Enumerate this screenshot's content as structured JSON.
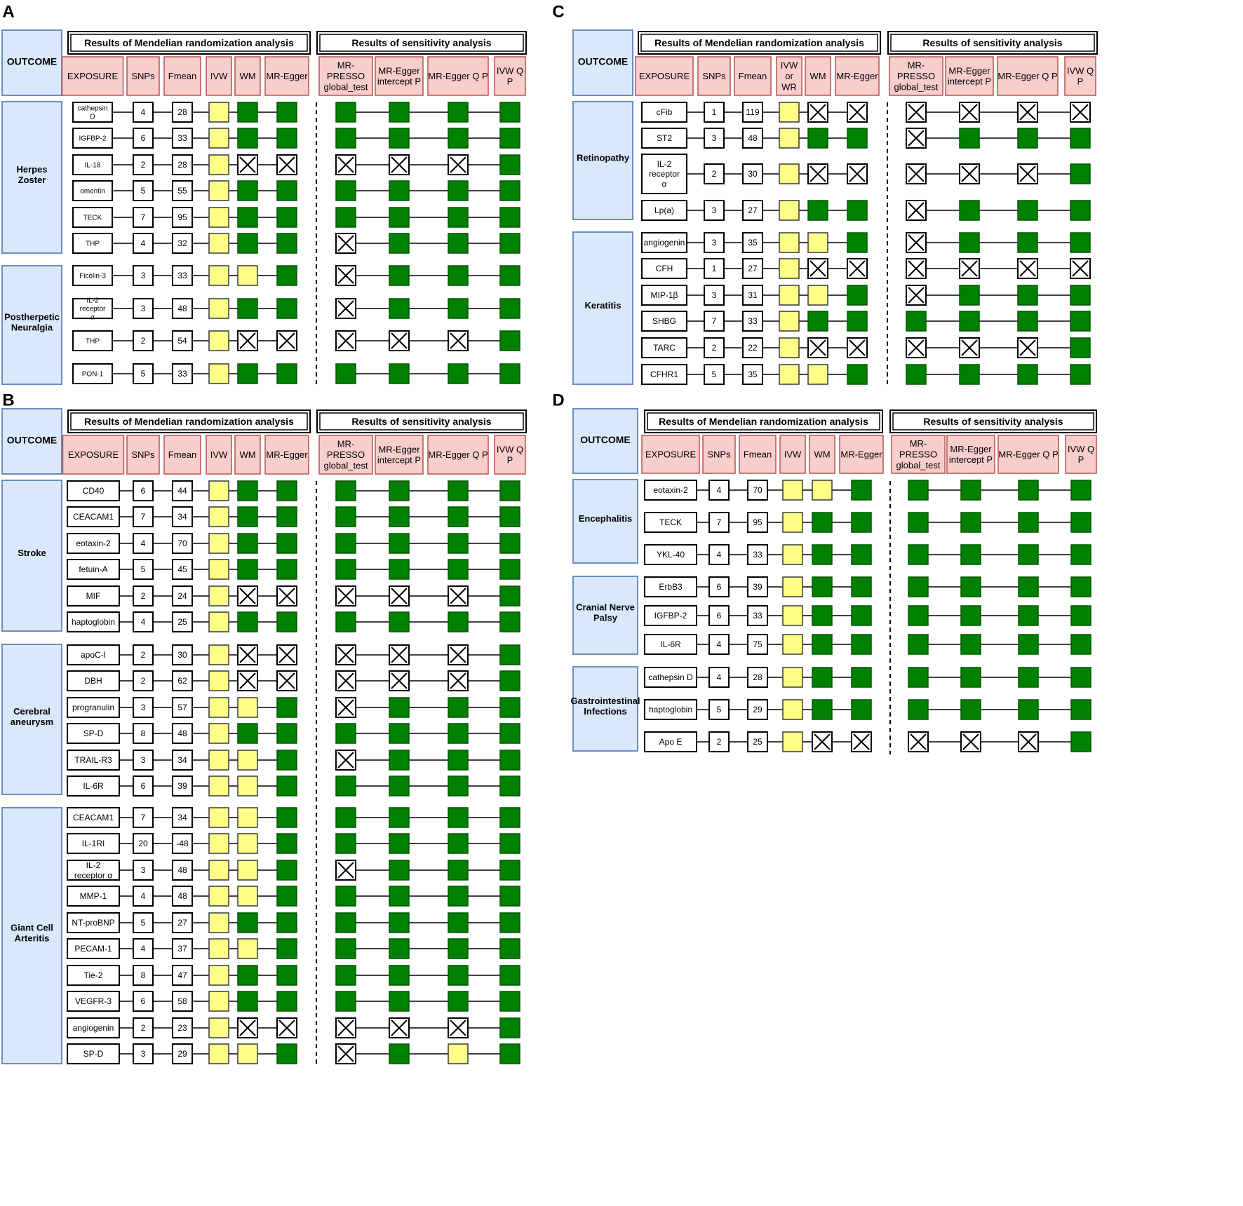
{
  "legend_colors": {
    "header_fill": "#f8cecc",
    "header_stroke": "#b85450",
    "outcome_fill": "#dae8fc",
    "outcome_stroke": "#6c8ebf",
    "ivw_yellow": "#ffff88",
    "sig_green": "#008000",
    "x_box": "cross"
  },
  "cell_codes": {
    "Y": "yellow box",
    "G": "green box",
    "X": "box with cross"
  },
  "panels": [
    {
      "letter": "A",
      "outcome_header": "OUTCOME",
      "mr_title": "Results of Mendelian randomization analysis",
      "sens_title": "Results of sensitivity analysis",
      "col_headers": [
        "EXPOSURE",
        "SNPs",
        "Fmean",
        "IVW",
        "WM",
        "MR-Egger",
        "MR-PRESSO global_test",
        "MR-Egger intercept P",
        "MR-Egger Q P",
        "IVW Q P"
      ],
      "groups": [
        {
          "outcome": "Herpes Zoster",
          "rows": [
            {
              "exposure": "cathepsin D",
              "snps": "4",
              "fmean": "28",
              "cells": [
                "Y",
                "G",
                "G",
                "G",
                "G",
                "G",
                "G"
              ]
            },
            {
              "exposure": "IGFBP-2",
              "snps": "6",
              "fmean": "33",
              "cells": [
                "Y",
                "G",
                "G",
                "G",
                "G",
                "G",
                "G"
              ]
            },
            {
              "exposure": "IL-18",
              "snps": "2",
              "fmean": "28",
              "cells": [
                "Y",
                "X",
                "X",
                "X",
                "X",
                "X",
                "G"
              ]
            },
            {
              "exposure": "omentin",
              "snps": "5",
              "fmean": "55",
              "cells": [
                "Y",
                "G",
                "G",
                "G",
                "G",
                "G",
                "G"
              ]
            },
            {
              "exposure": "TECK",
              "snps": "7",
              "fmean": "95",
              "cells": [
                "Y",
                "G",
                "G",
                "G",
                "G",
                "G",
                "G"
              ]
            },
            {
              "exposure": "THP",
              "snps": "4",
              "fmean": "32",
              "cells": [
                "Y",
                "G",
                "G",
                "X",
                "G",
                "G",
                "G"
              ]
            }
          ]
        },
        {
          "outcome": "Postherpetic Neuralgia",
          "rows": [
            {
              "exposure": "Ficolin-3",
              "snps": "3",
              "fmean": "33",
              "cells": [
                "Y",
                "Y",
                "G",
                "X",
                "G",
                "G",
                "G"
              ]
            },
            {
              "exposure": "IL-2 receptor α",
              "snps": "3",
              "fmean": "48",
              "cells": [
                "Y",
                "G",
                "G",
                "X",
                "G",
                "G",
                "G"
              ]
            },
            {
              "exposure": "THP",
              "snps": "2",
              "fmean": "54",
              "cells": [
                "Y",
                "X",
                "X",
                "X",
                "X",
                "X",
                "G"
              ]
            },
            {
              "exposure": "PON-1",
              "snps": "5",
              "fmean": "33",
              "cells": [
                "Y",
                "G",
                "G",
                "G",
                "G",
                "G",
                "G"
              ]
            }
          ]
        }
      ]
    },
    {
      "letter": "B",
      "outcome_header": "OUTCOME",
      "mr_title": "Results of Mendelian randomization analysis",
      "sens_title": "Results of sensitivity analysis",
      "col_headers": [
        "EXPOSURE",
        "SNPs",
        "Fmean",
        "IVW",
        "WM",
        "MR-Egger",
        "MR-PRESSO global_test",
        "MR-Egger intercept P",
        "MR-Egger Q P",
        "IVW Q P"
      ],
      "groups": [
        {
          "outcome": "Stroke",
          "rows": [
            {
              "exposure": "CD40",
              "snps": "6",
              "fmean": "44",
              "cells": [
                "Y",
                "G",
                "G",
                "G",
                "G",
                "G",
                "G"
              ]
            },
            {
              "exposure": "CEACAM1",
              "snps": "7",
              "fmean": "34",
              "cells": [
                "Y",
                "G",
                "G",
                "G",
                "G",
                "G",
                "G"
              ]
            },
            {
              "exposure": "eotaxin-2",
              "snps": "4",
              "fmean": "70",
              "cells": [
                "Y",
                "G",
                "G",
                "G",
                "G",
                "G",
                "G"
              ]
            },
            {
              "exposure": "fetuin-A",
              "snps": "5",
              "fmean": "45",
              "cells": [
                "Y",
                "G",
                "G",
                "G",
                "G",
                "G",
                "G"
              ]
            },
            {
              "exposure": "MIF",
              "snps": "2",
              "fmean": "24",
              "cells": [
                "Y",
                "X",
                "X",
                "X",
                "X",
                "X",
                "G"
              ]
            },
            {
              "exposure": "haptoglobin",
              "snps": "4",
              "fmean": "25",
              "cells": [
                "Y",
                "G",
                "G",
                "G",
                "G",
                "G",
                "G"
              ]
            }
          ]
        },
        {
          "outcome": "Cerebral aneurysm",
          "rows": [
            {
              "exposure": "apoC-I",
              "snps": "2",
              "fmean": "30",
              "cells": [
                "Y",
                "X",
                "X",
                "X",
                "X",
                "X",
                "G"
              ]
            },
            {
              "exposure": "DBH",
              "snps": "2",
              "fmean": "62",
              "cells": [
                "Y",
                "X",
                "X",
                "X",
                "X",
                "X",
                "G"
              ]
            },
            {
              "exposure": "progranulin",
              "snps": "3",
              "fmean": "57",
              "cells": [
                "Y",
                "Y",
                "G",
                "X",
                "G",
                "G",
                "G"
              ]
            },
            {
              "exposure": "SP-D",
              "snps": "8",
              "fmean": "48",
              "cells": [
                "Y",
                "G",
                "G",
                "G",
                "G",
                "G",
                "G"
              ]
            },
            {
              "exposure": "TRAIL-R3",
              "snps": "3",
              "fmean": "34",
              "cells": [
                "Y",
                "Y",
                "G",
                "X",
                "G",
                "G",
                "G"
              ]
            },
            {
              "exposure": "IL-6R",
              "snps": "6",
              "fmean": "39",
              "cells": [
                "Y",
                "Y",
                "G",
                "G",
                "G",
                "G",
                "G"
              ]
            }
          ]
        },
        {
          "outcome": "Giant Cell Arteritis",
          "rows": [
            {
              "exposure": "CEACAM1",
              "snps": "7",
              "fmean": "34",
              "cells": [
                "Y",
                "Y",
                "G",
                "G",
                "G",
                "G",
                "G"
              ]
            },
            {
              "exposure": "IL-1RI",
              "snps": "20",
              "fmean": "-48",
              "cells": [
                "Y",
                "Y",
                "G",
                "G",
                "G",
                "G",
                "G"
              ]
            },
            {
              "exposure": "IL-2 receptor α",
              "snps": "3",
              "fmean": "48",
              "cells": [
                "Y",
                "Y",
                "G",
                "X",
                "G",
                "G",
                "G"
              ]
            },
            {
              "exposure": "MMP-1",
              "snps": "4",
              "fmean": "48",
              "cells": [
                "Y",
                "Y",
                "G",
                "G",
                "G",
                "G",
                "G"
              ]
            },
            {
              "exposure": "NT-proBNP",
              "snps": "5",
              "fmean": "27",
              "cells": [
                "Y",
                "G",
                "G",
                "G",
                "G",
                "G",
                "G"
              ]
            },
            {
              "exposure": "PECAM-1",
              "snps": "4",
              "fmean": "37",
              "cells": [
                "Y",
                "Y",
                "G",
                "G",
                "G",
                "G",
                "G"
              ]
            },
            {
              "exposure": "Tie-2",
              "snps": "8",
              "fmean": "47",
              "cells": [
                "Y",
                "G",
                "G",
                "G",
                "G",
                "G",
                "G"
              ]
            },
            {
              "exposure": "VEGFR-3",
              "snps": "6",
              "fmean": "58",
              "cells": [
                "Y",
                "G",
                "G",
                "G",
                "G",
                "G",
                "G"
              ]
            },
            {
              "exposure": "angiogenin",
              "snps": "2",
              "fmean": "23",
              "cells": [
                "Y",
                "X",
                "X",
                "X",
                "X",
                "X",
                "G"
              ]
            },
            {
              "exposure": "SP-D",
              "snps": "3",
              "fmean": "29",
              "cells": [
                "Y",
                "Y",
                "G",
                "X",
                "G",
                "Y",
                "G"
              ]
            }
          ]
        }
      ]
    },
    {
      "letter": "C",
      "outcome_header": "OUTCOME",
      "mr_title": "Results of Mendelian randomization analysis",
      "sens_title": "Results of sensitivity analysis",
      "col_headers": [
        "EXPOSURE",
        "SNPs",
        "Fmean",
        "IVW or WR",
        "WM",
        "MR-Egger",
        "MR-PRESSO global_test",
        "MR-Egger intercept P",
        "MR-Egger Q P",
        "IVW Q P"
      ],
      "groups": [
        {
          "outcome": "Retinopathy",
          "rows": [
            {
              "exposure": "cFib",
              "snps": "1",
              "fmean": "119",
              "cells": [
                "Y",
                "X",
                "X",
                "X",
                "X",
                "X",
                "X"
              ]
            },
            {
              "exposure": "ST2",
              "snps": "3",
              "fmean": "48",
              "cells": [
                "Y",
                "G",
                "G",
                "X",
                "G",
                "G",
                "G"
              ]
            },
            {
              "exposure": "IL-2 receptor α",
              "snps": "2",
              "fmean": "30",
              "cells": [
                "Y",
                "X",
                "X",
                "X",
                "X",
                "X",
                "G"
              ]
            },
            {
              "exposure": "Lp(a)",
              "snps": "3",
              "fmean": "27",
              "cells": [
                "Y",
                "G",
                "G",
                "X",
                "G",
                "G",
                "G"
              ]
            }
          ]
        },
        {
          "outcome": "Keratitis",
          "rows": [
            {
              "exposure": "angiogenin",
              "snps": "3",
              "fmean": "35",
              "cells": [
                "Y",
                "Y",
                "G",
                "X",
                "G",
                "G",
                "G"
              ]
            },
            {
              "exposure": "CFH",
              "snps": "1",
              "fmean": "27",
              "cells": [
                "Y",
                "X",
                "X",
                "X",
                "X",
                "X",
                "X"
              ]
            },
            {
              "exposure": "MIP-1β",
              "snps": "3",
              "fmean": "31",
              "cells": [
                "Y",
                "Y",
                "G",
                "X",
                "G",
                "G",
                "G"
              ]
            },
            {
              "exposure": "SHBG",
              "snps": "7",
              "fmean": "33",
              "cells": [
                "Y",
                "G",
                "G",
                "G",
                "G",
                "G",
                "G"
              ]
            },
            {
              "exposure": "TARC",
              "snps": "2",
              "fmean": "22",
              "cells": [
                "Y",
                "X",
                "X",
                "X",
                "X",
                "X",
                "G"
              ]
            },
            {
              "exposure": "CFHR1",
              "snps": "5",
              "fmean": "35",
              "cells": [
                "Y",
                "Y",
                "G",
                "G",
                "G",
                "G",
                "G"
              ]
            }
          ]
        }
      ]
    },
    {
      "letter": "D",
      "outcome_header": "OUTCOME",
      "mr_title": "Results of Mendelian randomization analysis",
      "sens_title": "Results of sensitivity analysis",
      "col_headers": [
        "EXPOSURE",
        "SNPs",
        "Fmean",
        "IVW",
        "WM",
        "MR-Egger",
        "MR-PRESSO global_test",
        "MR-Egger intercept P",
        "MR-Egger Q P",
        "IVW Q P"
      ],
      "groups": [
        {
          "outcome": "Encephalitis",
          "rows": [
            {
              "exposure": "eotaxin-2",
              "snps": "4",
              "fmean": "70",
              "cells": [
                "Y",
                "Y",
                "G",
                "G",
                "G",
                "G",
                "G"
              ]
            },
            {
              "exposure": "TECK",
              "snps": "7",
              "fmean": "95",
              "cells": [
                "Y",
                "G",
                "G",
                "G",
                "G",
                "G",
                "G"
              ]
            },
            {
              "exposure": "YKL-40",
              "snps": "4",
              "fmean": "33",
              "cells": [
                "Y",
                "G",
                "G",
                "G",
                "G",
                "G",
                "G"
              ]
            }
          ]
        },
        {
          "outcome": "Cranial Nerve Palsy",
          "rows": [
            {
              "exposure": "ErbB3",
              "snps": "6",
              "fmean": "39",
              "cells": [
                "Y",
                "G",
                "G",
                "G",
                "G",
                "G",
                "G"
              ]
            },
            {
              "exposure": "IGFBP-2",
              "snps": "6",
              "fmean": "33",
              "cells": [
                "Y",
                "G",
                "G",
                "G",
                "G",
                "G",
                "G"
              ]
            },
            {
              "exposure": "IL-6R",
              "snps": "4",
              "fmean": "75",
              "cells": [
                "Y",
                "G",
                "G",
                "G",
                "G",
                "G",
                "G"
              ]
            }
          ]
        },
        {
          "outcome": "Gastrointestinal Infections",
          "rows": [
            {
              "exposure": "cathepsin D",
              "snps": "4",
              "fmean": "28",
              "cells": [
                "Y",
                "G",
                "G",
                "G",
                "G",
                "G",
                "G"
              ]
            },
            {
              "exposure": "haptoglobin",
              "snps": "5",
              "fmean": "29",
              "cells": [
                "Y",
                "G",
                "G",
                "G",
                "G",
                "G",
                "G"
              ]
            },
            {
              "exposure": "Apo E",
              "snps": "2",
              "fmean": "25",
              "cells": [
                "Y",
                "X",
                "X",
                "X",
                "X",
                "X",
                "G"
              ]
            }
          ]
        }
      ]
    }
  ]
}
